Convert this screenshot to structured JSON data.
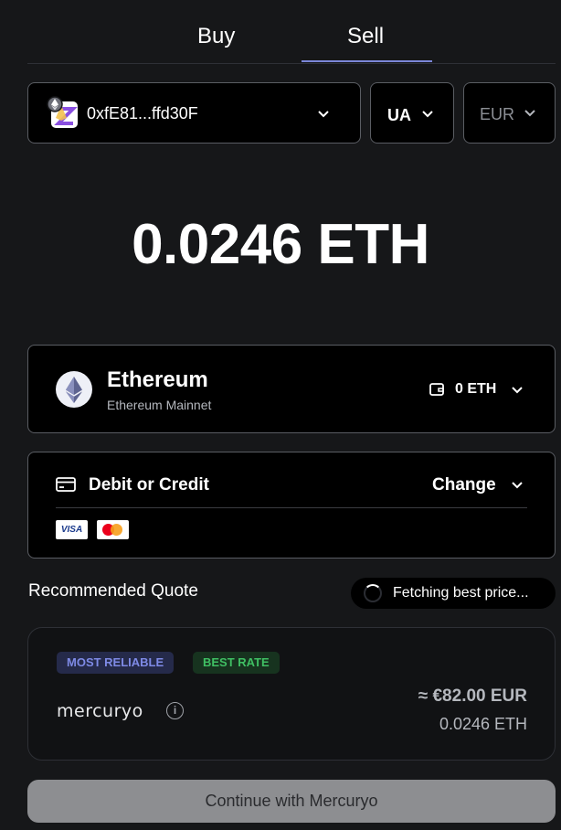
{
  "tabs": {
    "buy": "Buy",
    "sell": "Sell",
    "active": "Sell"
  },
  "wallet": {
    "address": "0xfE81...ffd30F",
    "icon": "ethereum-account-icon"
  },
  "country": {
    "code": "UA"
  },
  "currency": {
    "code": "EUR"
  },
  "amount": {
    "display": "0.0246 ETH"
  },
  "asset": {
    "name": "Ethereum",
    "network": "Ethereum Mainnet",
    "balance": "0 ETH",
    "icon": "ethereum-icon"
  },
  "payment": {
    "method": "Debit or Credit",
    "change_label": "Change",
    "cards": [
      "VISA",
      "mastercard"
    ]
  },
  "recommended": {
    "title": "Recommended Quote",
    "status": "Fetching best price..."
  },
  "quote": {
    "badges": [
      "MOST RELIABLE",
      "BEST RATE"
    ],
    "provider": "mercuryo",
    "fiat_amount": "≈ €82.00 EUR",
    "crypto_amount": "0.0246 ETH"
  },
  "cta": {
    "label": "Continue with Mercuryo"
  },
  "colors": {
    "background": "#161719",
    "accent": "#7b86d8",
    "reliable_badge": "#7e8ae6",
    "best_rate_badge": "#3fbf63",
    "button_disabled": "#8d8e91"
  }
}
